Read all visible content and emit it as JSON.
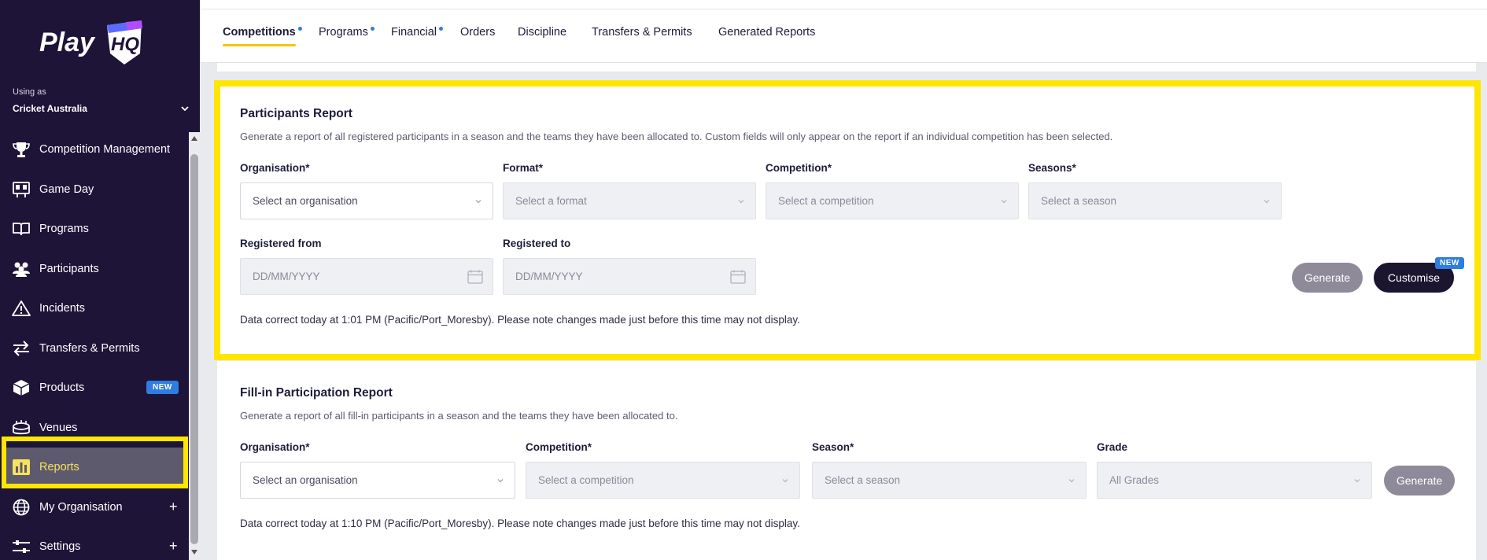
{
  "brand": {
    "logo_text": "Play",
    "logo_hq": "HQ"
  },
  "account": {
    "using_as_label": "Using as",
    "org_name": "Cricket Australia"
  },
  "sidebar": {
    "items": [
      {
        "label": "Competition Management",
        "icon": "trophy-icon"
      },
      {
        "label": "Game Day",
        "icon": "scoreboard-icon"
      },
      {
        "label": "Programs",
        "icon": "book-icon"
      },
      {
        "label": "Participants",
        "icon": "people-icon"
      },
      {
        "label": "Incidents",
        "icon": "warning-icon"
      },
      {
        "label": "Transfers & Permits",
        "icon": "transfer-icon"
      },
      {
        "label": "Products",
        "icon": "box-icon",
        "badge": "NEW"
      },
      {
        "label": "Venues",
        "icon": "stadium-icon"
      },
      {
        "label": "Reports",
        "icon": "chart-icon",
        "active": true
      },
      {
        "label": "My Organisation",
        "icon": "globe-icon",
        "expand": "+"
      },
      {
        "label": "Settings",
        "icon": "sliders-icon",
        "expand": "+"
      }
    ]
  },
  "tabs": [
    {
      "label": "Competitions",
      "active": true,
      "dot": true
    },
    {
      "label": "Programs",
      "dot": true
    },
    {
      "label": "Financial",
      "dot": true
    },
    {
      "label": "Orders"
    },
    {
      "label": "Discipline"
    },
    {
      "label": "Transfers & Permits"
    },
    {
      "label": "Generated Reports"
    }
  ],
  "participants_report": {
    "title": "Participants Report",
    "description": "Generate a report of all registered participants in a season and the teams they have been allocated to. Custom fields will only appear on the report if an individual competition has been selected.",
    "fields": {
      "organisation": {
        "label": "Organisation*",
        "placeholder": "Select an organisation"
      },
      "format": {
        "label": "Format*",
        "placeholder": "Select a format"
      },
      "competition": {
        "label": "Competition*",
        "placeholder": "Select a competition"
      },
      "seasons": {
        "label": "Seasons*",
        "placeholder": "Select a season"
      },
      "registered_from": {
        "label": "Registered from",
        "placeholder": "DD/MM/YYYY"
      },
      "registered_to": {
        "label": "Registered to",
        "placeholder": "DD/MM/YYYY"
      }
    },
    "generate_label": "Generate",
    "customise_label": "Customise",
    "customise_badge": "NEW",
    "note": "Data correct today at 1:01 PM (Pacific/Port_Moresby). Please note changes made just before this time may not display."
  },
  "fillin_report": {
    "title": "Fill-in Participation Report",
    "description": "Generate a report of all fill-in participants in a season and the teams they have been allocated to.",
    "fields": {
      "organisation": {
        "label": "Organisation*",
        "placeholder": "Select an organisation"
      },
      "competition": {
        "label": "Competition*",
        "placeholder": "Select a competition"
      },
      "season": {
        "label": "Season*",
        "placeholder": "Select a season"
      },
      "grade": {
        "label": "Grade",
        "placeholder": "All Grades"
      }
    },
    "generate_label": "Generate",
    "note": "Data correct today at 1:10 PM (Pacific/Port_Moresby). Please note changes made just before this time may not display."
  },
  "colors": {
    "sidebar_bg": "#1e1438",
    "highlight": "#ffe600",
    "accent_blue": "#2f7de1",
    "tab_underline": "#f3c700",
    "active_text": "#f6e35e"
  }
}
